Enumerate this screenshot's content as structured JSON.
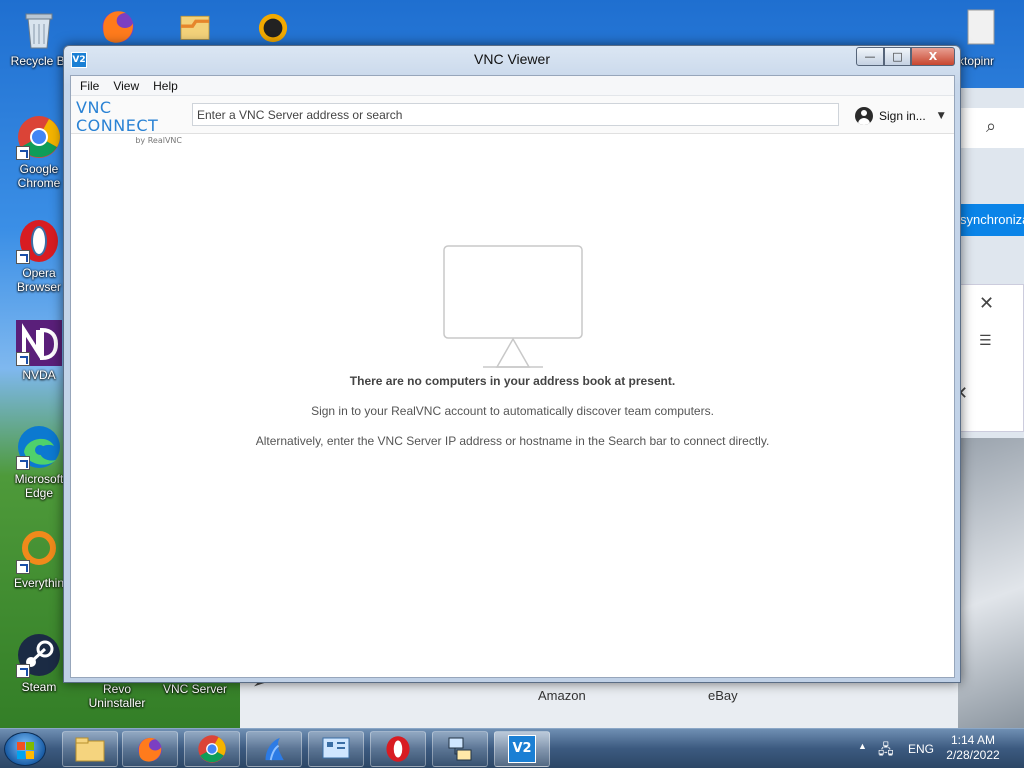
{
  "desktop": {
    "icons": [
      {
        "label": "Recycle Bi",
        "name": "recycle-bin"
      },
      {
        "label": "Google Chrome",
        "name": "google-chrome"
      },
      {
        "label": "Opera Browser",
        "name": "opera-browser"
      },
      {
        "label": "NVDA",
        "name": "nvda"
      },
      {
        "label": "Microsoft Edge",
        "name": "microsoft-edge"
      },
      {
        "label": "Everythin",
        "name": "everything"
      },
      {
        "label": "Steam",
        "name": "steam"
      },
      {
        "label": "Revo Uninstaller",
        "name": "revo-uninstaller"
      },
      {
        "label": "VNC Server",
        "name": "vnc-server"
      },
      {
        "label": "ktopinr",
        "name": "desktop-partial"
      }
    ]
  },
  "background_window": {
    "sync_label": "synchroniza",
    "tiles": [
      "Amazon",
      "eBay"
    ]
  },
  "vnc": {
    "title": "VNC Viewer",
    "title_icon": "V2",
    "controls": {
      "minimize": "—",
      "maximize": "□",
      "close": "X"
    },
    "menu": [
      "File",
      "View",
      "Help"
    ],
    "logo": {
      "main": "VNC CONNECT",
      "sub": "by RealVNC"
    },
    "search": {
      "placeholder": "Enter a VNC Server address or search",
      "value": ""
    },
    "signin_label": "Sign in...",
    "empty": {
      "title": "There are no computers in your address book at present.",
      "line1": "Sign in to your RealVNC account to automatically discover team computers.",
      "line2": "Alternatively, enter the VNC Server IP address or hostname in the Search bar to connect directly."
    }
  },
  "taskbar": {
    "apps": [
      "file-explorer",
      "firefox",
      "chrome",
      "unknown-app",
      "control-panel",
      "opera",
      "network-app",
      "vnc-viewer"
    ],
    "language": "ENG",
    "time": "1:14 AM",
    "date": "2/28/2022"
  },
  "colors": {
    "accent": "#1a7fd4",
    "sync_button": "#0a84e8",
    "close_button": "#c8462f"
  }
}
